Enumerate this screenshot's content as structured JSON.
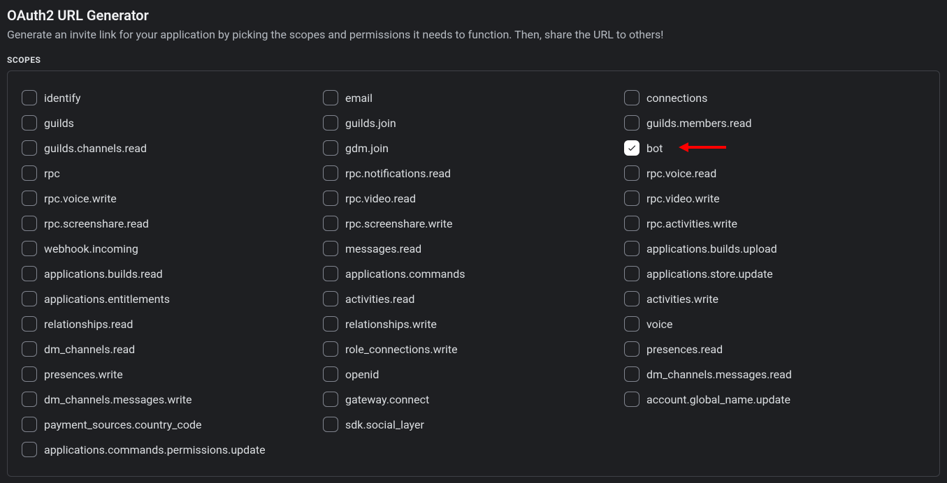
{
  "header": {
    "title": "OAuth2 URL Generator",
    "subtitle": "Generate an invite link for your application by picking the scopes and permissions it needs to function. Then, share the URL to others!"
  },
  "section_label": "SCOPES",
  "columns": [
    [
      {
        "label": "identify",
        "checked": false
      },
      {
        "label": "guilds",
        "checked": false
      },
      {
        "label": "guilds.channels.read",
        "checked": false
      },
      {
        "label": "rpc",
        "checked": false
      },
      {
        "label": "rpc.voice.write",
        "checked": false
      },
      {
        "label": "rpc.screenshare.read",
        "checked": false
      },
      {
        "label": "webhook.incoming",
        "checked": false
      },
      {
        "label": "applications.builds.read",
        "checked": false
      },
      {
        "label": "applications.entitlements",
        "checked": false
      },
      {
        "label": "relationships.read",
        "checked": false
      },
      {
        "label": "dm_channels.read",
        "checked": false
      },
      {
        "label": "presences.write",
        "checked": false
      },
      {
        "label": "dm_channels.messages.write",
        "checked": false
      },
      {
        "label": "payment_sources.country_code",
        "checked": false
      },
      {
        "label": "applications.commands.permissions.update",
        "checked": false
      }
    ],
    [
      {
        "label": "email",
        "checked": false
      },
      {
        "label": "guilds.join",
        "checked": false
      },
      {
        "label": "gdm.join",
        "checked": false
      },
      {
        "label": "rpc.notifications.read",
        "checked": false
      },
      {
        "label": "rpc.video.read",
        "checked": false
      },
      {
        "label": "rpc.screenshare.write",
        "checked": false
      },
      {
        "label": "messages.read",
        "checked": false
      },
      {
        "label": "applications.commands",
        "checked": false
      },
      {
        "label": "activities.read",
        "checked": false
      },
      {
        "label": "relationships.write",
        "checked": false
      },
      {
        "label": "role_connections.write",
        "checked": false
      },
      {
        "label": "openid",
        "checked": false
      },
      {
        "label": "gateway.connect",
        "checked": false
      },
      {
        "label": "sdk.social_layer",
        "checked": false
      }
    ],
    [
      {
        "label": "connections",
        "checked": false
      },
      {
        "label": "guilds.members.read",
        "checked": false
      },
      {
        "label": "bot",
        "checked": true
      },
      {
        "label": "rpc.voice.read",
        "checked": false
      },
      {
        "label": "rpc.video.write",
        "checked": false
      },
      {
        "label": "rpc.activities.write",
        "checked": false
      },
      {
        "label": "applications.builds.upload",
        "checked": false
      },
      {
        "label": "applications.store.update",
        "checked": false
      },
      {
        "label": "activities.write",
        "checked": false
      },
      {
        "label": "voice",
        "checked": false
      },
      {
        "label": "presences.read",
        "checked": false
      },
      {
        "label": "dm_channels.messages.read",
        "checked": false
      },
      {
        "label": "account.global_name.update",
        "checked": false
      }
    ]
  ],
  "annotation": {
    "color": "#ff0000"
  }
}
